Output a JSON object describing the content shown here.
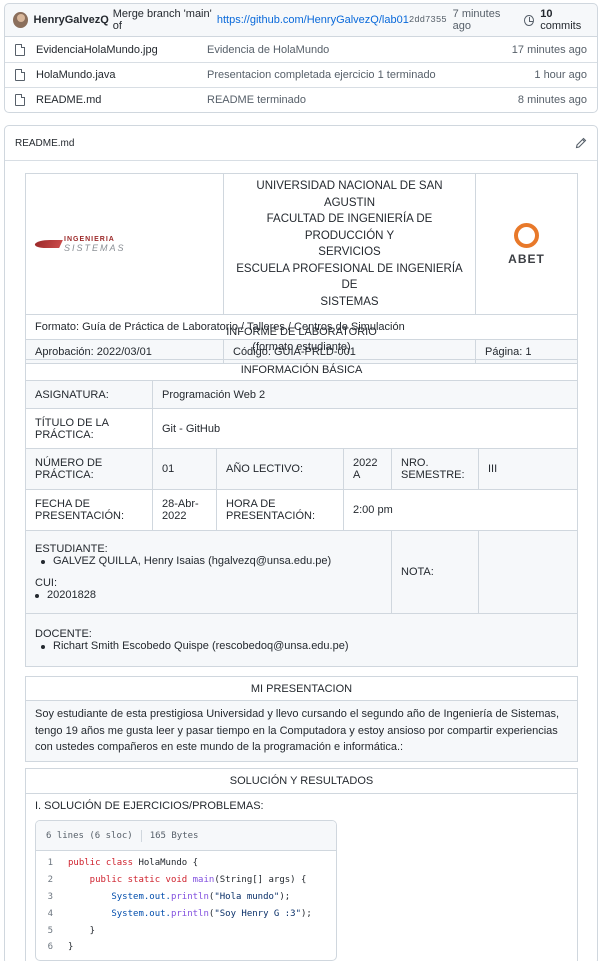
{
  "commit": {
    "author": "HenryGalvezQ",
    "message": "Merge branch 'main' of",
    "link": "https://github.com/HenryGalvezQ/lab01",
    "sha": "2dd7355",
    "time": "7 minutes ago",
    "commits_count": "10",
    "commits_label": "commits"
  },
  "files": [
    {
      "name": "EvidenciaHolaMundo.jpg",
      "message": "Evidencia de HolaMundo",
      "age": "17 minutes ago"
    },
    {
      "name": "HolaMundo.java",
      "message": "Presentacion completada ejercicio 1 terminado",
      "age": "1 hour ago"
    },
    {
      "name": "README.md",
      "message": "README terminado",
      "age": "8 minutes ago"
    }
  ],
  "readme": {
    "title": "README.md",
    "header": {
      "uni_line1": "UNIVERSIDAD NACIONAL DE SAN AGUSTIN",
      "uni_line2": "FACULTAD DE INGENIERÍA DE PRODUCCIÓN Y",
      "uni_line3": "SERVICIOS",
      "uni_line4": "ESCUELA PROFESIONAL DE INGENIERÍA DE",
      "uni_line5": "SISTEMAS",
      "logo_word1": "INGENIERIA",
      "logo_word2": "SISTEMAS",
      "abet": "ABET",
      "formato": "Formato: Guía de Práctica de Laboratorio / Talleres / Centros de Simulación",
      "aprobacion": "Aprobación: 2022/03/01",
      "codigo": "Código: GUIA-PRLD-001",
      "pagina": "Página: 1"
    },
    "informe_title": "INFORME DE LABORATORIO",
    "informe_sub": "(formato estudiante)",
    "info": {
      "title": "INFORMACIÓN BÁSICA",
      "asignatura_label": "ASIGNATURA:",
      "asignatura": "Programación Web 2",
      "titulo_label": "TÍTULO DE LA PRÁCTICA:",
      "titulo": "Git - GitHub",
      "numero_label": "NÚMERO DE PRÁCTICA:",
      "numero": "01",
      "anio_label": "AÑO LECTIVO:",
      "anio": "2022 A",
      "semestre_label": "NRO. SEMESTRE:",
      "semestre": "III",
      "fecha_label": "FECHA DE PRESENTACIÓN:",
      "fecha": "28-Abr-2022",
      "hora_label": "HORA DE PRESENTACIÓN:",
      "hora": "2:00 pm",
      "estudiante_label": "ESTUDIANTE:",
      "estudiante": "GALVEZ QUILLA, Henry Isaias (hgalvezq@unsa.edu.pe)",
      "cui_label": "CUI:",
      "cui": "20201828",
      "nota_label": "NOTA:",
      "docente_label": "DOCENTE:",
      "docente": "Richart Smith Escobedo Quispe (rescobedoq@unsa.edu.pe)"
    },
    "presentacion": {
      "title": "MI PRESENTACION",
      "text": "Soy estudiante de esta prestigiosa Universidad y llevo cursando el segundo año de Ingeniería de Sistemas, tengo 19 años me gusta leer y pasar tiempo en la Computadora y estoy ansioso por compartir experiencias con ustedes compañeros en este mundo de la programación e informática.:"
    },
    "solucion": {
      "title": "SOLUCIÓN Y RESULTADOS",
      "subtitle": "I. SOLUCIÓN DE EJERCICIOS/PROBLEMAS:",
      "code_lines_info": "6 lines (6 sloc)",
      "code_size": "165 Bytes",
      "code": [
        {
          "n": "1",
          "kw1": "public class ",
          "name": "HolaMundo",
          "rest": " {"
        },
        {
          "n": "2",
          "kw1": "    public static ",
          "name": "void ",
          "fn": "main",
          "rest": "(String[] args) {"
        },
        {
          "n": "3",
          "obj": "        System",
          "mid": ".out.",
          "fn": "println",
          "rest": "(",
          "str": "\"Hola mundo\"",
          "end": ");"
        },
        {
          "n": "4",
          "obj": "        System",
          "mid": ".out.",
          "fn": "println",
          "rest": "(",
          "str": "\"Soy Henry G :3\"",
          "end": ");"
        },
        {
          "n": "5",
          "plain": "    }"
        },
        {
          "n": "6",
          "plain": "}"
        }
      ]
    }
  }
}
